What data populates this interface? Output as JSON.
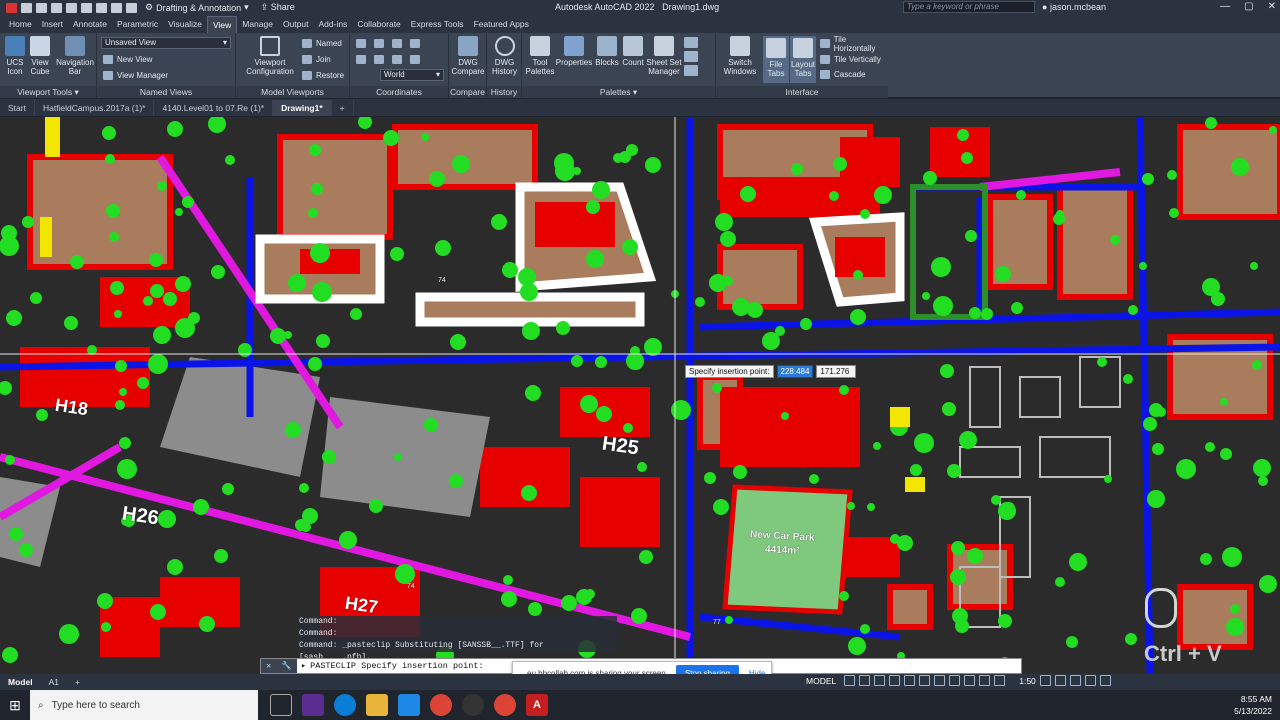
{
  "app": {
    "title": "Autodesk AutoCAD 2022",
    "file": "Drawing1.dwg",
    "workspace": "Drafting & Annotation",
    "share_label": "Share",
    "search_placeholder": "Type a keyword or phrase",
    "user": "jason.mcbean"
  },
  "ribbon_tabs": [
    "Home",
    "Insert",
    "Annotate",
    "Parametric",
    "Visualize",
    "View",
    "Manage",
    "Output",
    "Add-ins",
    "Collaborate",
    "Express Tools",
    "Featured Apps"
  ],
  "active_ribbon_tab": "View",
  "ribbon": {
    "viewport_tools": {
      "title": "Viewport Tools",
      "ucs_icon": "UCS Icon",
      "view_cube": "View Cube",
      "nav_bar": "Navigation Bar"
    },
    "named_views": {
      "title": "Named Views",
      "combo": "Unsaved View",
      "new_view": "New View",
      "view_manager": "View Manager"
    },
    "model_viewports": {
      "title": "Model Viewports",
      "viewport_config": "Viewport Configuration",
      "named": "Named",
      "join": "Join",
      "restore": "Restore"
    },
    "coordinates": {
      "title": "Coordinates",
      "world": "World"
    },
    "compare": {
      "title": "Compare",
      "dwg_compare": "DWG Compare"
    },
    "history": {
      "title": "History",
      "dwg_history": "DWG History"
    },
    "palettes": {
      "title": "Palettes",
      "tool_palettes": "Tool Palettes",
      "properties": "Properties",
      "blocks": "Blocks",
      "count": "Count",
      "sheet_set": "Sheet Set Manager"
    },
    "interface": {
      "title": "Interface",
      "switch_windows": "Switch Windows",
      "file_tabs": "File Tabs",
      "layout_tabs": "Layout Tabs",
      "tile_h": "Tile Horizontally",
      "tile_v": "Tile Vertically",
      "cascade": "Cascade"
    }
  },
  "doc_tabs": [
    {
      "label": "Start",
      "active": false
    },
    {
      "label": "HatfieldCampus.2017a (1)*",
      "active": false
    },
    {
      "label": "4140.Level01 to 07.Re (1)*",
      "active": false
    },
    {
      "label": "Drawing1*",
      "active": true
    }
  ],
  "drawing_labels": {
    "h18": "H18",
    "h25": "H25",
    "h26": "H26",
    "h27": "H27",
    "car_park": "New Car Park",
    "car_park_area": "4414m²",
    "num_74a": "74",
    "num_74b": "74",
    "num_77": "77"
  },
  "insertion_tooltip": {
    "prompt": "Specify insertion point:",
    "x": "228.484",
    "y": "171.276"
  },
  "command_history": [
    "Command:",
    "Command:",
    "Command: _pasteclip Substituting [SANSSB__.TTF] for [sasb____.pfb]."
  ],
  "command_line": "PASTECLIP Specify insertion point:",
  "share_bar": {
    "text": "eu.bbcollab.com is sharing your screen.",
    "stop": "Stop sharing",
    "hide": "Hide"
  },
  "layout_tabs": [
    "Model",
    "A1"
  ],
  "status": {
    "mode": "MODEL",
    "scale": "1:50"
  },
  "taskbar": {
    "search_placeholder": "Type here to search",
    "time": "8:55 AM",
    "date": "5/13/2022"
  },
  "overlay_key": "Ctrl + V",
  "colors": {
    "road": "#0a14e6",
    "building": "#e60000",
    "footprint": "#a87c5c",
    "tree": "#22dd22",
    "background": "#2b2b2b",
    "accent": "#2e7bd6"
  }
}
